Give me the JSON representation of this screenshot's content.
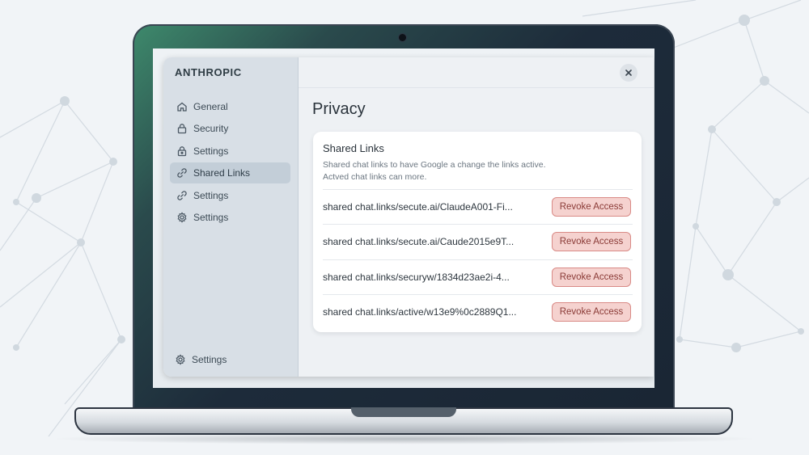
{
  "brand": "ANTHROPIC",
  "sidebar": {
    "items": [
      {
        "label": "General",
        "icon": "home-icon",
        "active": false
      },
      {
        "label": "Security",
        "icon": "lock-icon",
        "active": false
      },
      {
        "label": "Settings",
        "icon": "lock-icon",
        "active": false
      },
      {
        "label": "Shared Links",
        "icon": "link-icon",
        "active": true
      },
      {
        "label": "Settings",
        "icon": "link-icon",
        "active": false
      },
      {
        "label": "Settings",
        "icon": "gear-icon",
        "active": false
      }
    ],
    "footer": {
      "label": "Settings",
      "icon": "gear-icon"
    }
  },
  "page": {
    "title": "Privacy"
  },
  "shared_links": {
    "title": "Shared Links",
    "description_line1": "Shared chat links to have Google a change the links active.",
    "description_line2": "Actved chat links can more.",
    "revoke_label": "Revoke Access",
    "links": [
      "shared chat.links/secute.ai/ClaudeA001-Fi...",
      "shared chat.links/secute.ai/Caude2015e9T...",
      "shared chat.links/securyw/1834d23ae2i-4...",
      "shared chat.links/active/w13e9%0c2889Q1..."
    ]
  },
  "colors": {
    "accent_active": "#c3ced8",
    "revoke_bg": "#f5d2cf",
    "revoke_border": "#d98a86",
    "revoke_text": "#8a3a36"
  }
}
